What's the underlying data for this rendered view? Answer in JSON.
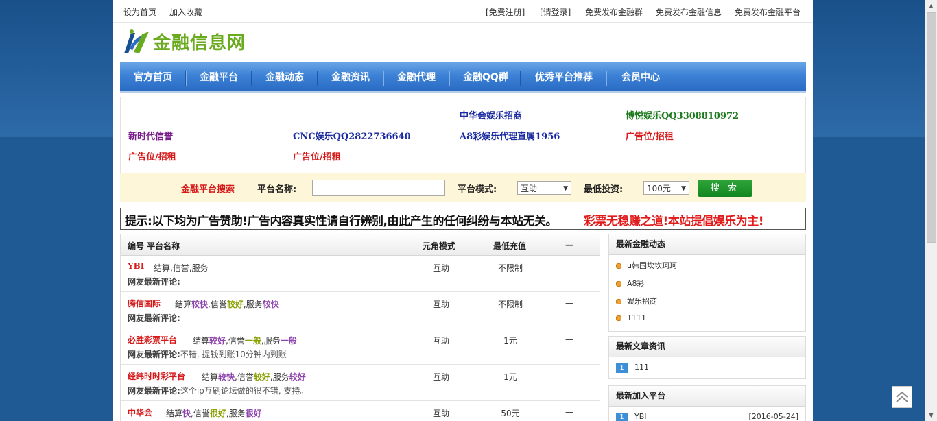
{
  "topbar": {
    "left_links": [
      "设为首页",
      "加入收藏"
    ],
    "right_links": [
      "[免费注册]",
      "[请登录]",
      "免费发布金融群",
      "免费发布金融信息",
      "免费发布金融平台"
    ]
  },
  "logo": {
    "text": "金融信息网"
  },
  "nav": [
    "官方首页",
    "金融平台",
    "金融动态",
    "金融资讯",
    "金融代理",
    "金融QQ群",
    "优秀平台推荐",
    "会员中心"
  ],
  "ads": {
    "row1": [
      "中华会娱乐招商",
      "博悦娱乐QQ3308810972"
    ],
    "row2": [
      "新时代信誉",
      "CNC娱乐QQ2822736640",
      "A8彩娱乐代理直属1956",
      "广告位/招租"
    ],
    "row3": [
      "广告位/招租",
      "广告位/招租"
    ]
  },
  "colors": {
    "ad_purple": "#7a1f8a",
    "ad_blue": "#1a2aa0",
    "ad_green": "#1d7a1d",
    "ad_red": "#d61a1a"
  },
  "search": {
    "title": "金融平台搜索",
    "name_label": "平台名称:",
    "name_value": "",
    "mode_label": "平台模式:",
    "mode_value": "互助",
    "min_label": "最低投资:",
    "min_value": "100元",
    "button": "搜 索"
  },
  "notice": {
    "text": "提示:以下均为广告赞助!广告内容真实性请自行辨别,由此产生的任何纠纷与本站无关。",
    "highlight": "彩票无稳赚之道!本站提倡娱乐为主!"
  },
  "table": {
    "headers": {
      "num_name": "编号 平台名称",
      "mode": "元角模式",
      "min": "最低充值",
      "more": "—"
    },
    "comment_label": "网友最新评论:",
    "labels": {
      "settle": "结算",
      "credit": "信誉",
      "service": "服务"
    },
    "rows": [
      {
        "name": "YBI",
        "plain": "结算,信誉,服务",
        "mode": "互助",
        "min": "不限制",
        "more": "—",
        "comment": ""
      },
      {
        "name": "腾信国际",
        "settle": "较快",
        "credit": "较好",
        "service": "较快",
        "mode": "互助",
        "min": "不限制",
        "more": "—",
        "comment": ""
      },
      {
        "name": "必胜彩票平台",
        "settle": "较好",
        "credit": "一般",
        "service": "一般",
        "mode": "互助",
        "min": "1元",
        "more": "—",
        "comment": "不错, 提钱到账10分钟内到账"
      },
      {
        "name": "经纬时时彩平台",
        "settle": "较快",
        "credit": "较好",
        "service": "较好",
        "mode": "互助",
        "min": "1元",
        "more": "—",
        "comment": "这个ip互刷论坛做的很不错, 支持。"
      },
      {
        "name": "中华会",
        "settle": "快",
        "credit": "很好",
        "service": "很好",
        "mode": "互助",
        "min": "50元",
        "more": "—",
        "comment": ""
      }
    ]
  },
  "news": {
    "title": "最新金融动态",
    "items": [
      "u韩国坎坎珂珂",
      "A8彩",
      "娱乐招商",
      "1111"
    ]
  },
  "articles": {
    "title": "最新文章资讯",
    "items": [
      {
        "num": "1",
        "text": "111"
      }
    ]
  },
  "newplatforms": {
    "title": "最新加入平台",
    "items": [
      {
        "num": "1",
        "text": "YBI",
        "date": "[2016-05-24]"
      }
    ]
  }
}
